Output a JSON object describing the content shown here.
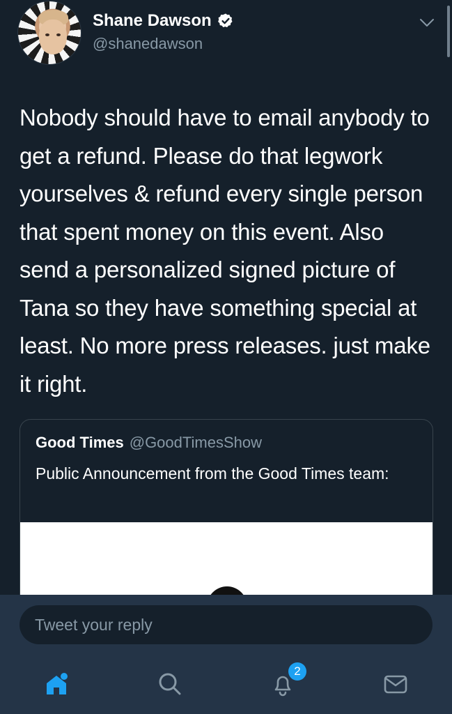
{
  "author": {
    "name": "Shane Dawson",
    "handle": "@shanedawson",
    "avatar_icon": "profile-photo"
  },
  "tweet": {
    "text": "Nobody should have to email anybody to get a refund. Please do that legwork yourselves & refund every single person that spent money on this event. Also send a personalized signed picture of Tana so they have something special at least. No more press releases. just make it right."
  },
  "quoted_tweet": {
    "name": "Good Times",
    "handle": "@GoodTimesShow",
    "text": "Public Announcement from the Good Times team:"
  },
  "reply": {
    "placeholder": "Tweet your reply"
  },
  "nav": {
    "items": [
      {
        "icon": "home-icon"
      },
      {
        "icon": "search-icon"
      },
      {
        "icon": "notifications-icon"
      },
      {
        "icon": "messages-icon"
      }
    ],
    "notifications_count": "2"
  },
  "colors": {
    "background": "#15202b",
    "bottom_bar": "#243447",
    "accent": "#1da1f2",
    "secondary_text": "#8899a6"
  }
}
